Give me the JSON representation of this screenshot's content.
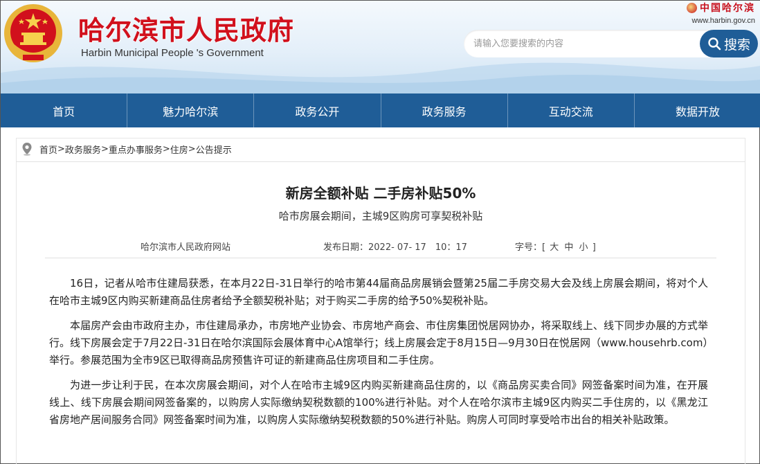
{
  "header": {
    "site_name_cn": "哈尔滨市人民政府",
    "site_name_en": "Harbin Municipal People 's Government",
    "brand_cn": "中国哈尔滨",
    "brand_url": "www.harbin.gov.cn"
  },
  "search": {
    "placeholder": "请输入您要搜索的内容",
    "button_label": "搜索"
  },
  "nav": {
    "items": [
      "首页",
      "魅力哈尔滨",
      "政务公开",
      "政务服务",
      "互动交流",
      "数据开放"
    ]
  },
  "breadcrumb": {
    "items": [
      "首页",
      "政务服务",
      "重点办事服务",
      "住房",
      "公告提示"
    ],
    "separator": ">"
  },
  "article": {
    "title": "新房全额补贴 二手房补贴50%",
    "subtitle": "哈市房展会期间，主城9区购房可享契税补贴",
    "source": "哈尔滨市人民政府网站",
    "date_label": "发布日期：",
    "date_value": "2022- 07- 17　10：17",
    "fontsize_label": "字号：",
    "fontsize_open": "[",
    "fontsize_options": [
      "大",
      "中",
      "小"
    ],
    "fontsize_close": "]",
    "paragraphs": [
      "16日，记者从哈市住建局获悉，在本月22日-31日举行的哈市第44届商品房展销会暨第25届二手房交易大会及线上房展会期间，将对个人在哈市主城9区内购买新建商品住房者给予全额契税补贴；对于购买二手房的给予50%契税补贴。",
      "本届房产会由市政府主办，市住建局承办，市房地产业协会、市房地产商会、市住房集团悦居网协办，将采取线上、线下同步办展的方式举行。线下房展会定于7月22日-31日在哈尔滨国际会展体育中心A馆举行；线上房展会定于8月15日—9月30日在悦居网（www.househrb.com）举行。参展范围为全市9区已取得商品房预售许可证的新建商品住房项目和二手住房。",
      "为进一步让利于民，在本次房展会期间，对个人在哈市主城9区内购买新建商品住房的，以《商品房买卖合同》网签备案时间为准，在开展线上、线下房展会期间网签备案的，以购房人实际缴纳契税数额的100%进行补贴。对个人在哈尔滨市主城9区内购买二手住房的，以《黑龙江省房地产居间服务合同》网签备案时间为准，以购房人实际缴纳契税数额的50%进行补贴。购房人可同时享受哈市出台的相关补贴政策。"
    ]
  },
  "colors": {
    "nav_blue": "#1f5d97",
    "title_red": "#d1101c"
  }
}
